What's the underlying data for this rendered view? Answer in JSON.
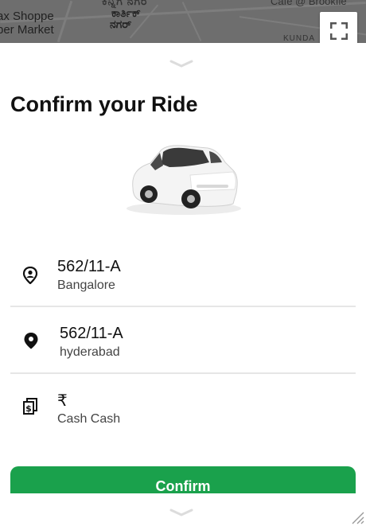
{
  "map": {
    "labels": {
      "shop_line1": "ax Shoppe",
      "shop_line2": "per Market",
      "top_road": "ಕಿನ್ನಿಗ ನಗರ",
      "area_line1": "ಕಾರ್ತಿಕ್",
      "area_line2": "ನಗರ್",
      "cafe": "Cafe @ Brookfie",
      "district": "KUNDA"
    }
  },
  "fullscreen": {
    "icon": "fullscreen-icon"
  },
  "sheet": {
    "title": "Confirm your Ride",
    "pickup": {
      "icon": "user-pin-icon",
      "address": "562/11-A",
      "city": "Bangalore"
    },
    "dropoff": {
      "icon": "location-pin-icon",
      "address": "562/11-A",
      "city": "hyderabad"
    },
    "payment": {
      "icon": "cash-icon",
      "currency": "₹",
      "method": "Cash Cash"
    },
    "confirm_label": "Confirm"
  },
  "colors": {
    "confirm": "#1aa14c",
    "map": "#6e6e6e"
  }
}
